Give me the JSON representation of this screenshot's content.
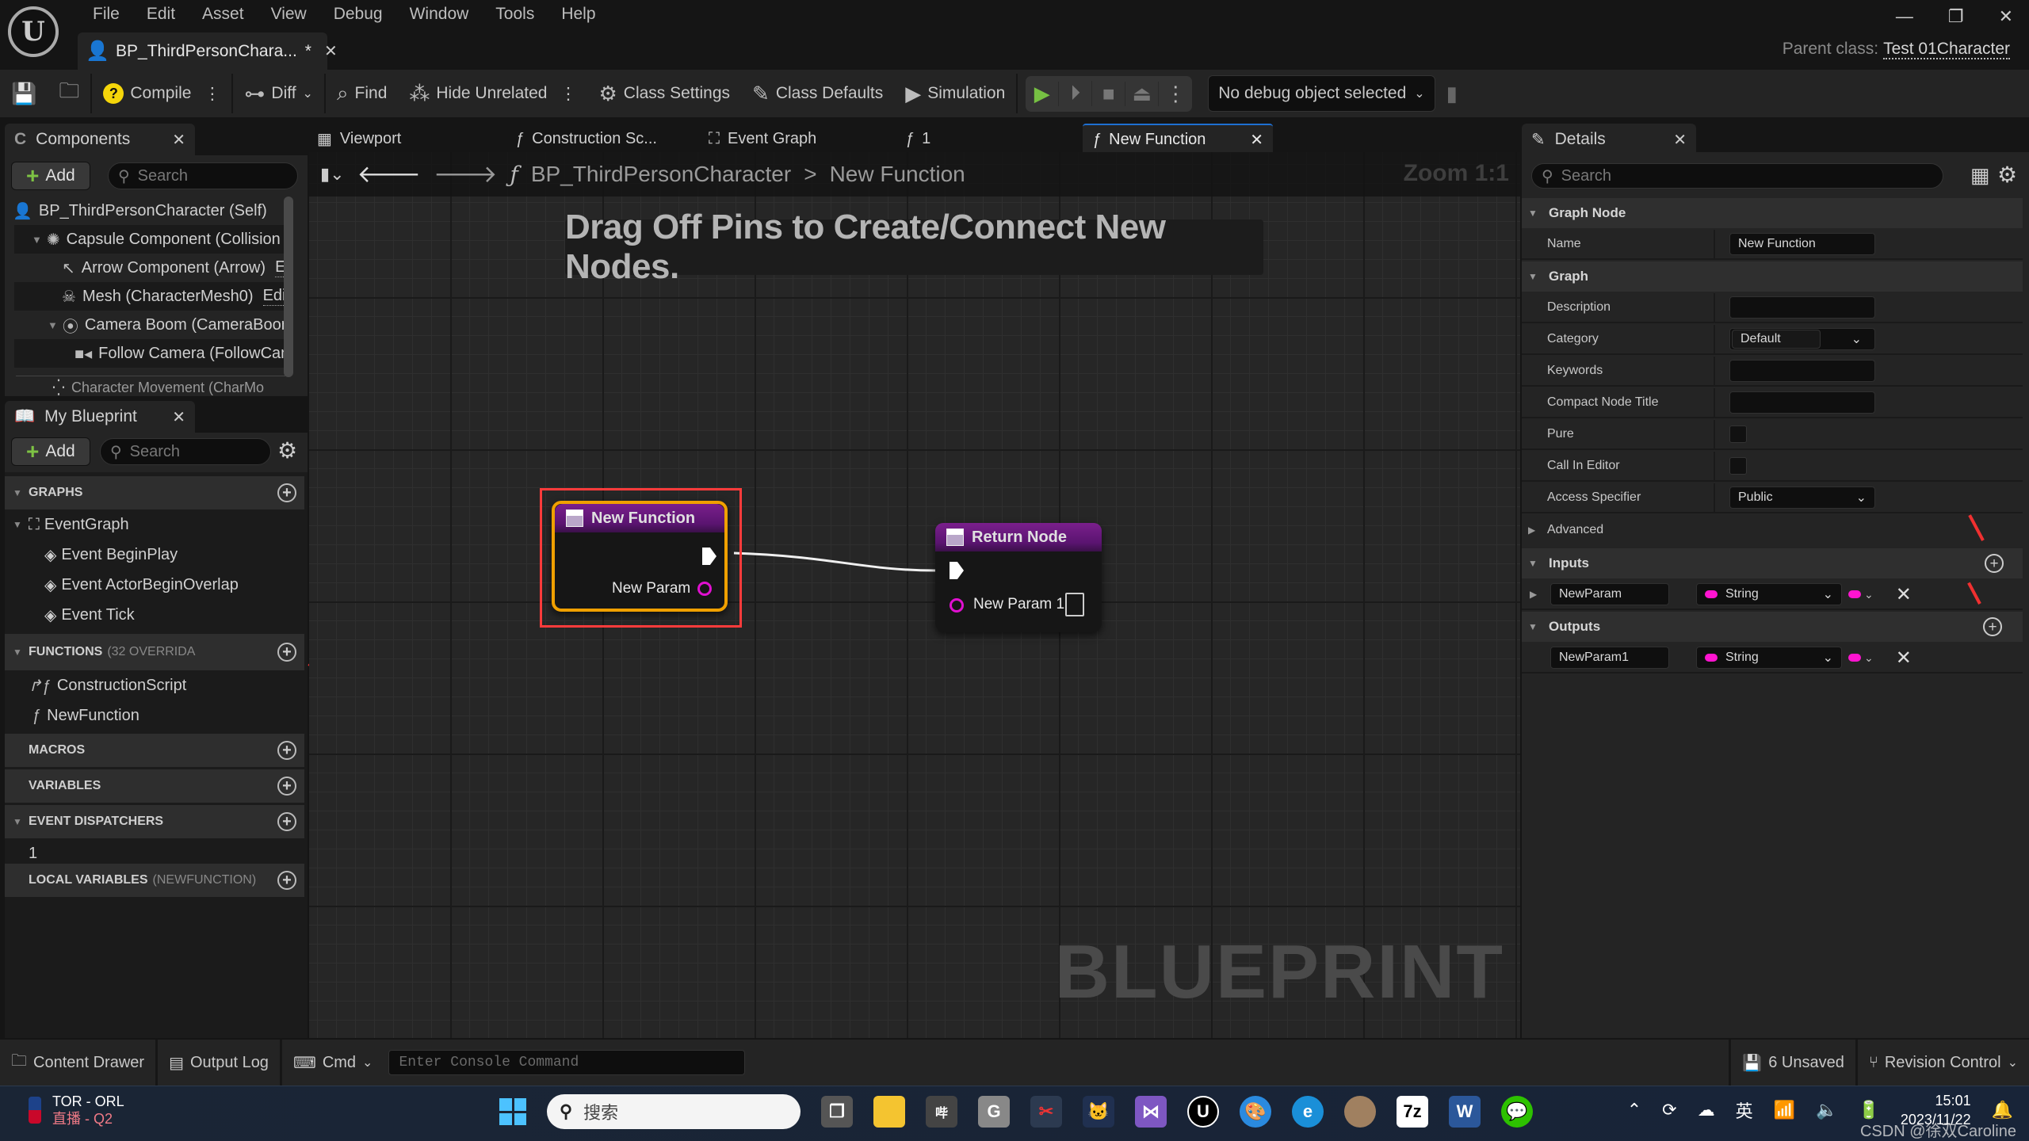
{
  "titlebar": {
    "menu": [
      "File",
      "Edit",
      "Asset",
      "View",
      "Debug",
      "Window",
      "Tools",
      "Help"
    ],
    "document_tab": "BP_ThirdPersonChara...",
    "dirty_marker": "*",
    "parent_class_label": "Parent class:",
    "parent_class_value": "Test 01Character"
  },
  "toolbar": {
    "compile": "Compile",
    "diff": "Diff",
    "find": "Find",
    "hide_unrelated": "Hide Unrelated",
    "class_settings": "Class Settings",
    "class_defaults": "Class Defaults",
    "simulation": "Simulation",
    "debug_object": "No debug object selected"
  },
  "components": {
    "tab": "Components",
    "add": "Add",
    "search_placeholder": "Search",
    "tree": [
      {
        "label": "BP_ThirdPersonCharacter (Self)",
        "icon": "person-icon"
      },
      {
        "label": "Capsule Component (Collision",
        "icon": "capsule-icon"
      },
      {
        "label": "Arrow Component (Arrow)",
        "icon": "arrow-icon",
        "link": "E"
      },
      {
        "label": "Mesh (CharacterMesh0)",
        "icon": "skeleton-icon",
        "link": "Edi"
      },
      {
        "label": "Camera Boom (CameraBoon",
        "icon": "spring-arm-icon"
      },
      {
        "label": "Follow Camera (FollowCan",
        "icon": "camera-icon"
      },
      {
        "label": "Character Movement (CharMo",
        "icon": "movement-icon"
      }
    ]
  },
  "my_blueprint": {
    "tab": "My Blueprint",
    "add": "Add",
    "search_placeholder": "Search",
    "graphs": {
      "header": "GRAPHS",
      "items": [
        "EventGraph"
      ],
      "events": [
        "Event BeginPlay",
        "Event ActorBeginOverlap",
        "Event Tick"
      ]
    },
    "functions": {
      "header": "FUNCTIONS",
      "sub": "(32 OVERRIDA",
      "items": [
        "ConstructionScript",
        "NewFunction"
      ]
    },
    "macros": {
      "header": "MACROS"
    },
    "variables": {
      "header": "VARIABLES"
    },
    "event_dispatchers": {
      "header": "EVENT DISPATCHERS",
      "items": [
        "1"
      ]
    },
    "local_variables": {
      "header": "LOCAL VARIABLES",
      "sub": "(NEWFUNCTION)"
    }
  },
  "graph_tabs": [
    {
      "label": "Viewport",
      "icon": "viewport-icon"
    },
    {
      "label": "Construction Sc...",
      "icon": "function-icon"
    },
    {
      "label": "Event Graph",
      "icon": "event-graph-icon"
    },
    {
      "label": "1",
      "icon": "function-icon"
    },
    {
      "label": "New Function",
      "icon": "function-icon",
      "active": true
    }
  ],
  "graph": {
    "breadcrumb_root": "BP_ThirdPersonCharacter",
    "breadcrumb_sep": ">",
    "breadcrumb_current": "New Function",
    "zoom": "Zoom 1:1",
    "hint": "Drag Off Pins to Create/Connect New Nodes.",
    "watermark": "BLUEPRINT",
    "nodes": {
      "entry": {
        "title": "New Function",
        "pin": "New Param"
      },
      "return": {
        "title": "Return Node",
        "pin": "New Param 1"
      }
    }
  },
  "details": {
    "tab": "Details",
    "search_placeholder": "Search",
    "graph_node_header": "Graph Node",
    "name_label": "Name",
    "name_value": "New Function",
    "graph_header": "Graph",
    "description_label": "Description",
    "description_value": "",
    "category_label": "Category",
    "category_value": "Default",
    "keywords_label": "Keywords",
    "keywords_value": "",
    "compact_label": "Compact Node Title",
    "compact_value": "",
    "pure_label": "Pure",
    "pure_checked": false,
    "call_in_editor_label": "Call In Editor",
    "call_in_editor_checked": false,
    "access_label": "Access Specifier",
    "access_value": "Public",
    "advanced_label": "Advanced",
    "inputs_header": "Inputs",
    "inputs": [
      {
        "name": "NewParam",
        "type": "String"
      }
    ],
    "outputs_header": "Outputs",
    "outputs": [
      {
        "name": "NewParam1",
        "type": "String"
      }
    ],
    "pin_color": "#ff14d0"
  },
  "statusbar": {
    "content_drawer": "Content Drawer",
    "output_log": "Output Log",
    "cmd": "Cmd",
    "console_placeholder": "Enter Console Command",
    "unsaved": "6 Unsaved",
    "revision_control": "Revision Control"
  },
  "taskbar": {
    "widget_line1": "TOR - ORL",
    "widget_line2": "直播 - Q2",
    "search_placeholder": "搜索",
    "ime": "英",
    "time": "15:01",
    "date": "2023/11/22",
    "watermark": "CSDN @徐双Caroline"
  }
}
